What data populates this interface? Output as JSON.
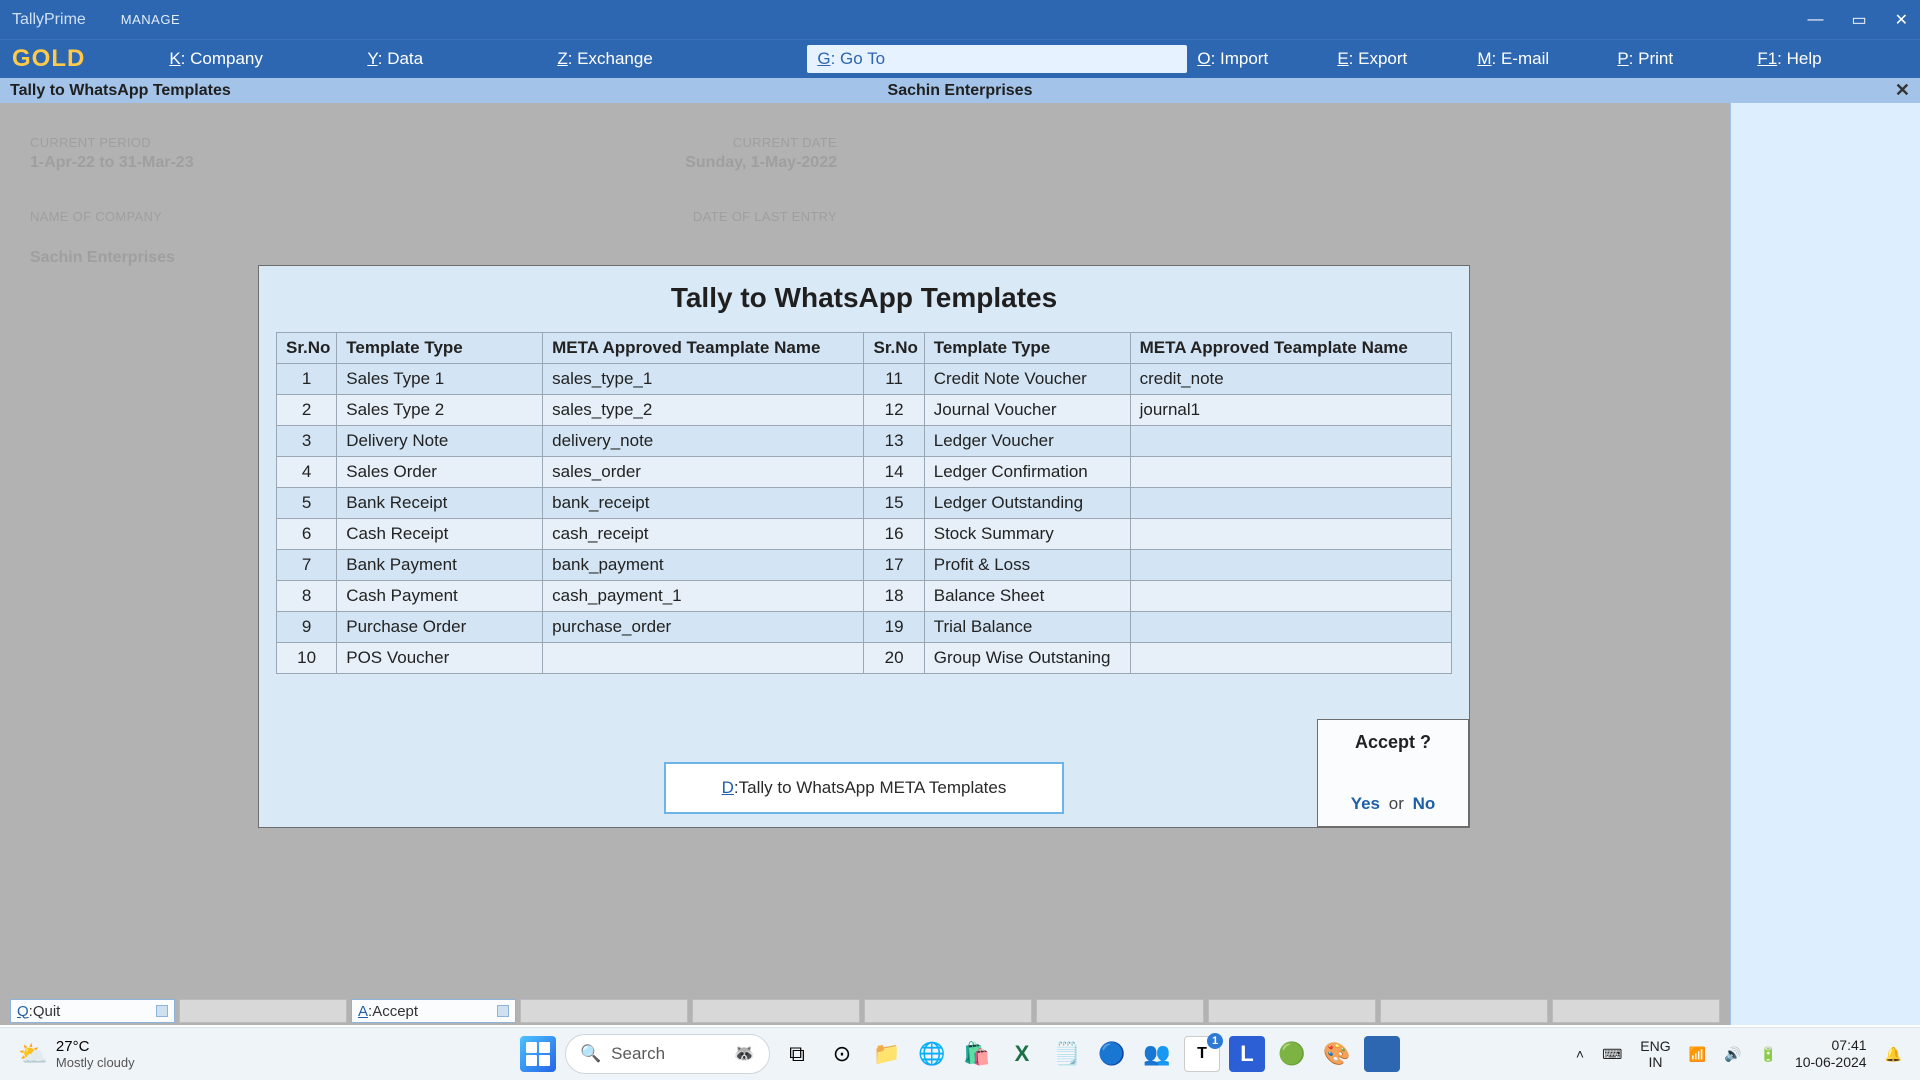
{
  "app": {
    "name": "TallyPrime",
    "edition": "GOLD",
    "manage": "MANAGE"
  },
  "menu": {
    "k": {
      "key": "K",
      "label": "Company"
    },
    "y": {
      "key": "Y",
      "label": "Data"
    },
    "z": {
      "key": "Z",
      "label": "Exchange"
    },
    "g": {
      "key": "G",
      "label": "Go To"
    },
    "o": {
      "key": "O",
      "label": "Import"
    },
    "e": {
      "key": "E",
      "label": "Export"
    },
    "m": {
      "key": "M",
      "label": "E-mail"
    },
    "p": {
      "key": "P",
      "label": "Print"
    },
    "f1": {
      "key": "F1",
      "label": "Help"
    }
  },
  "infobar": {
    "left": "Tally to WhatsApp Templates",
    "center": "Sachin Enterprises"
  },
  "bg": {
    "period_label": "CURRENT PERIOD",
    "period": "1-Apr-22 to 31-Mar-23",
    "date_label": "CURRENT DATE",
    "date": "Sunday, 1-May-2022",
    "company_label": "NAME OF COMPANY",
    "company": "Sachin Enterprises",
    "last_entry_label": "DATE OF LAST ENTRY"
  },
  "dialog": {
    "title": "Tally to WhatsApp Templates",
    "cols": {
      "sr": "Sr.No",
      "tt": "Template Type",
      "mn": "META Approved Teamplate Name"
    },
    "left": [
      {
        "sr": "1",
        "tt": "Sales Type 1",
        "mn": "sales_type_1"
      },
      {
        "sr": "2",
        "tt": "Sales Type 2",
        "mn": "sales_type_2"
      },
      {
        "sr": "3",
        "tt": "Delivery Note",
        "mn": "delivery_note"
      },
      {
        "sr": "4",
        "tt": "Sales Order",
        "mn": "sales_order"
      },
      {
        "sr": "5",
        "tt": "Bank Receipt",
        "mn": "bank_receipt"
      },
      {
        "sr": "6",
        "tt": "Cash Receipt",
        "mn": "cash_receipt"
      },
      {
        "sr": "7",
        "tt": "Bank Payment",
        "mn": "bank_payment"
      },
      {
        "sr": "8",
        "tt": "Cash Payment",
        "mn": "cash_payment_1"
      },
      {
        "sr": "9",
        "tt": "Purchase Order",
        "mn": "purchase_order"
      },
      {
        "sr": "10",
        "tt": "POS Voucher",
        "mn": ""
      }
    ],
    "right": [
      {
        "sr": "11",
        "tt": "Credit Note Voucher",
        "mn": "credit_note"
      },
      {
        "sr": "12",
        "tt": "Journal Voucher",
        "mn": "journal1"
      },
      {
        "sr": "13",
        "tt": "Ledger Voucher",
        "mn": ""
      },
      {
        "sr": "14",
        "tt": "Ledger Confirmation",
        "mn": ""
      },
      {
        "sr": "15",
        "tt": "Ledger Outstanding",
        "mn": ""
      },
      {
        "sr": "16",
        "tt": "Stock Summary",
        "mn": ""
      },
      {
        "sr": "17",
        "tt": "Profit & Loss",
        "mn": ""
      },
      {
        "sr": "18",
        "tt": "Balance Sheet",
        "mn": ""
      },
      {
        "sr": "19",
        "tt": "Trial Balance",
        "mn": ""
      },
      {
        "sr": "20",
        "tt": "Group Wise Outstaning",
        "mn": ""
      }
    ],
    "meta_btn": {
      "key": "D",
      "label": "Tally to WhatsApp META Templates"
    },
    "accept": {
      "q": "Accept ?",
      "yes": "Yes",
      "or": "or",
      "no": "No"
    }
  },
  "bottom": {
    "q": {
      "key": "Q",
      "label": "Quit"
    },
    "a": {
      "key": "A",
      "label": "Accept"
    }
  },
  "taskbar": {
    "weather": {
      "temp": "27°C",
      "cond": "Mostly cloudy"
    },
    "search": "Search",
    "lang1": "ENG",
    "lang2": "IN",
    "time": "07:41",
    "date": "10-06-2024"
  }
}
